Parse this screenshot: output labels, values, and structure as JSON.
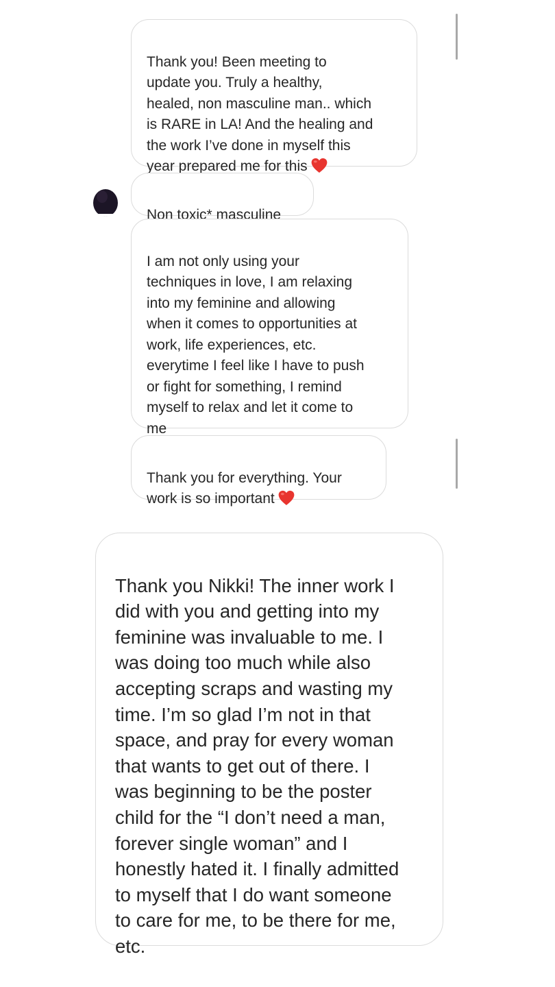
{
  "thread": {
    "messages": [
      {
        "id": "msg-1",
        "text": "Thank you! Been meeting to\nupdate you. Truly a healthy,\nhealed, non masculine man.. which\nis RARE in LA! And the healing and\nthe work I’ve done in myself this\nyear prepared me for this",
        "emoji": "red-heart-emoji"
      },
      {
        "id": "msg-2",
        "text": "Non toxic* masculine"
      },
      {
        "id": "msg-3",
        "text": "I am not only using your\ntechniques in love, I am relaxing\ninto my feminine and allowing\nwhen it comes to opportunities at\nwork, life experiences, etc.\neverytime I feel like I have to push\nor fight for something, I remind\nmyself to relax and let it come to\nme"
      },
      {
        "id": "msg-4",
        "text": "Thank you for everything. Your\nwork is so important",
        "emoji": "red-heart-emoji"
      },
      {
        "id": "msg-5",
        "text": "Thank you Nikki! The inner work I\ndid with you and getting into my\nfeminine was invaluable to me. I\nwas doing too much while also\naccepting scraps and wasting my\ntime. I’m so glad I’m not in that\nspace, and pray for every woman\nthat wants to get out of there. I\nwas beginning to be the poster\nchild for the “I don’t need a man,\nforever single woman” and I\nhonestly hated it. I finally admitted\nto myself that I do want someone\nto care for me, to be there for me,\netc."
      }
    ],
    "avatar_icon": "user-avatar-icon"
  },
  "colors": {
    "bubble_border": "#dbdbdb",
    "text": "#262626",
    "heart": "#e8352f",
    "scrollbar": "#a8a8a8"
  }
}
